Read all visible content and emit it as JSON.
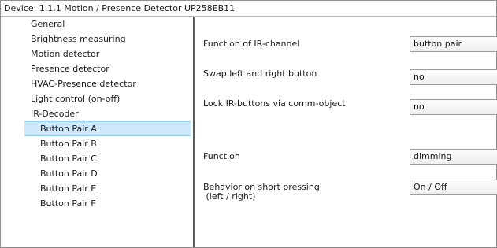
{
  "window": {
    "title": "Device: 1.1.1  Motion / Presence Detector UP258EB11"
  },
  "sidebar": {
    "items": [
      {
        "label": "General",
        "indent": 0,
        "selected": false
      },
      {
        "label": "Brightness measuring",
        "indent": 0,
        "selected": false
      },
      {
        "label": "Motion detector",
        "indent": 0,
        "selected": false
      },
      {
        "label": "Presence detector",
        "indent": 0,
        "selected": false
      },
      {
        "label": "HVAC-Presence detector",
        "indent": 0,
        "selected": false
      },
      {
        "label": "Light control (on-off)",
        "indent": 0,
        "selected": false
      },
      {
        "label": "IR-Decoder",
        "indent": 0,
        "selected": false
      },
      {
        "label": "Button Pair A",
        "indent": 1,
        "selected": true
      },
      {
        "label": "Button Pair B",
        "indent": 1,
        "selected": false
      },
      {
        "label": "Button Pair C",
        "indent": 1,
        "selected": false
      },
      {
        "label": "Button Pair D",
        "indent": 1,
        "selected": false
      },
      {
        "label": "Button Pair E",
        "indent": 1,
        "selected": false
      },
      {
        "label": "Button Pair F",
        "indent": 1,
        "selected": false
      }
    ]
  },
  "params": {
    "ir_channel": {
      "label": "Function of IR-channel",
      "value": "button pair"
    },
    "swap_buttons": {
      "label": "Swap left and right button",
      "value": "no"
    },
    "lock_buttons": {
      "label": "Lock IR-buttons via comm-object",
      "value": "no"
    },
    "function": {
      "label": "Function",
      "value": "dimming"
    },
    "short_press": {
      "label_line1": "Behavior on short pressing",
      "label_line2": " (left / right)",
      "value": "On / Off"
    }
  }
}
